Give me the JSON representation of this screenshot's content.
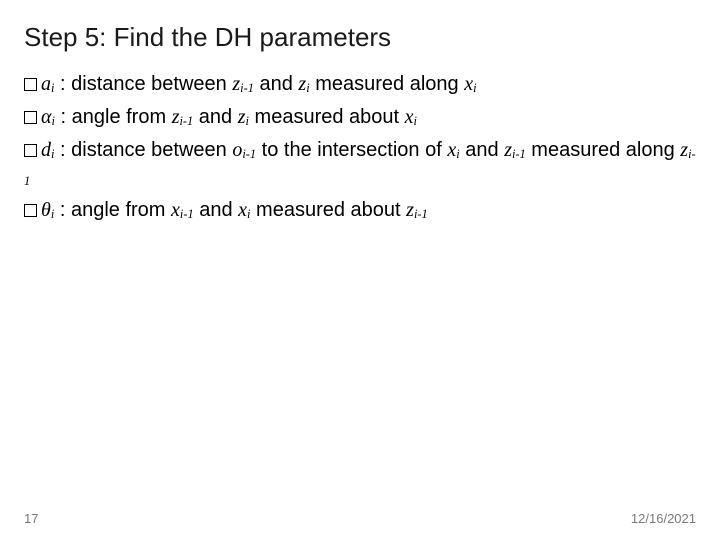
{
  "title": "Step 5: Find the DH parameters",
  "items": [
    {
      "sym_base": "a",
      "sym_sub": "i",
      "def_html": "distance between <span class='math'>z<span class='sub'>i-1</span></span> and <span class='math'>z<span class='sub'>i</span></span> measured along <span class='math'>x<span class='sub'>i</span></span>"
    },
    {
      "sym_base": "α",
      "sym_sub": "i",
      "def_html": "angle from <span class='math'>z<span class='sub'>i-1</span></span> and <span class='math'>z<span class='sub'>i</span></span> measured about <span class='math'>x<span class='sub'>i</span></span>"
    },
    {
      "sym_base": "d",
      "sym_sub": "i",
      "def_html": "distance between <span class='math'>o<span class='sub'>i-1</span></span> to the intersection of <span class='math'>x<span class='sub'>i</span></span> and <span class='math'>z<span class='sub'>i-1</span></span> measured along <span class='math'>z<span class='sub'>i-1</span></span>"
    },
    {
      "sym_base": "θ",
      "sym_sub": "i",
      "def_html": "angle from <span class='math'>x<span class='sub'>i-1</span></span> and <span class='math'>x<span class='sub'>i</span></span> measured about <span class='math'>z<span class='sub'>i-1</span></span>"
    }
  ],
  "footer": {
    "page": "17",
    "date": "12/16/2021"
  }
}
